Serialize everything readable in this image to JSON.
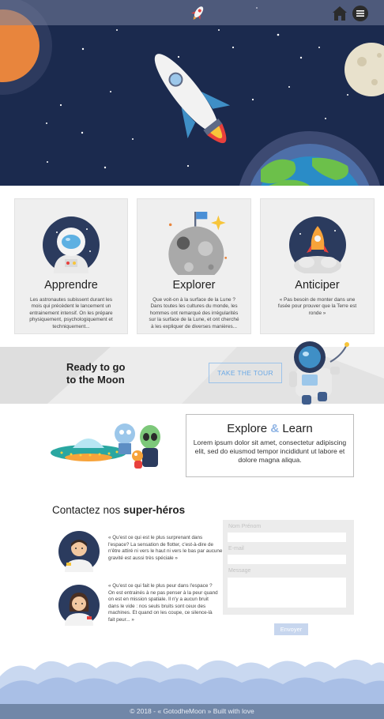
{
  "header": {
    "logo_icon": "rocket-icon",
    "home_icon": "home-icon",
    "menu_icon": "menu-icon"
  },
  "cards": [
    {
      "icon": "astronaut-icon",
      "title": "Apprendre",
      "text": "Les astronautes subissent durant les mois qui précèdent le lancement un entrainement intensif. On les prépare physiquement, psychologiquement et techniquement..."
    },
    {
      "icon": "moon-icon",
      "title": "Explorer",
      "text": "Que voit-on à la surface de la Lune ? Dans toutes les cultures du monde, les hommes ont remarqué des irrégularités sur la surface de la Lune, et ont cherché à les expliquer de diverses manières..."
    },
    {
      "icon": "rocket-launch-icon",
      "title": "Anticiper",
      "text": "« Pas besoin de monter dans une fusée pour prouver que la Terre est ronde »"
    }
  ],
  "banner": {
    "title_line1": "Ready to go",
    "title_line2": "to the Moon",
    "button_label": "TAKE THE TOUR"
  },
  "explore": {
    "title_a": "Explore",
    "title_amp": "&",
    "title_b": "Learn",
    "text": "Lorem ipsum dolor sit amet, consectetur adipiscing elit, sed do eiusmod tempor incididunt ut labore et dolore magna aliqua."
  },
  "contact": {
    "title_prefix": "Contactez nos",
    "title_bold": "super-héros",
    "quote1": "« Qu'est ce qui est le plus surprenant dans l'espace? La sensation de flotter, c'est-à-dire de n'être attiré ni vers le haut ni vers le bas par aucune gravité est aussi très spéciale »",
    "quote2": "« Qu'est ce qui fait le plus peur dans l'espace ? On est entrainés à ne pas penser à la peur quand on est en mission spatiale. Il n'y a aucun bruit dans le vide : nos seuls bruits sont ceux des machines. Et quand on les coupe, ce silence-là fait peur... »"
  },
  "form": {
    "name_placeholder": "Nom Prénom",
    "email_label": "E-mail",
    "message_label": "Message",
    "submit_label": "Envoyer"
  },
  "footer": {
    "prefix": "© 2018 - « ",
    "link": "GotodheMoon",
    "suffix": " » Built with love"
  },
  "colors": {
    "sky": "#1b2a4e",
    "accent": "#8fb4e4",
    "footer": "#7187a8"
  }
}
